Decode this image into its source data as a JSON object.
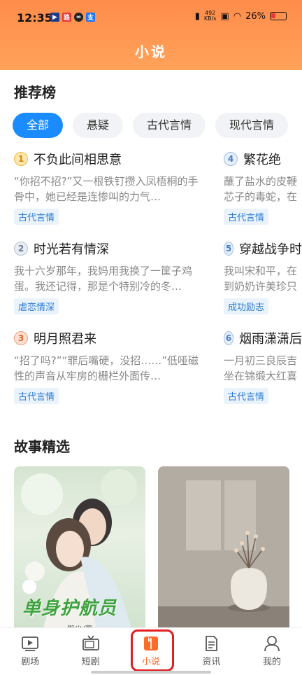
{
  "status_bar": {
    "time": "12:35",
    "net_speed_value": "492",
    "net_speed_unit": "KB/s",
    "battery": "26%"
  },
  "header": {
    "title": "小说"
  },
  "ranking": {
    "title": "推荐榜",
    "tabs": [
      "全部",
      "悬疑",
      "古代言情",
      "现代言情"
    ],
    "active_tab": "全部",
    "items": [
      {
        "rank": "1",
        "title": "不负此间相思意",
        "desc": "“你招不招?”又一根铁钉攒入凤梧桐的手骨中，她已经是连惨叫的力气…",
        "tag": "古代言情"
      },
      {
        "rank": "2",
        "title": "时光若有情深",
        "desc": "我十六岁那年，我妈用我换了一筐子鸡蛋。我还记得，那是个特别冷的冬…",
        "tag": "虐恋情深"
      },
      {
        "rank": "3",
        "title": "明月照君来",
        "desc": "“招了吗?”“罪后嘴硬，没招……”低哑磁性的声音从牢房的栅栏外面传…",
        "tag": "古代言情"
      },
      {
        "rank": "4",
        "title": "繁花绝",
        "desc": "蘸了盐水的皮鞭芯子的毒蛇，在",
        "tag": "古代言情"
      },
      {
        "rank": "5",
        "title": "穿越战争时",
        "desc": "我叫宋和平，在到奶奶许美珍只",
        "tag": "成功励志"
      },
      {
        "rank": "6",
        "title": "烟雨潇潇后",
        "desc": "一月初三良辰吉坐在锦缎大红喜",
        "tag": "古代言情"
      }
    ]
  },
  "stories": {
    "title": "故事精选",
    "items": [
      {
        "cover_title": "单身护航员",
        "cover_author": "舆尘/著"
      },
      {
        "cover_title": "",
        "cover_author": ""
      }
    ]
  },
  "bottom_nav": {
    "items": [
      "剧场",
      "短剧",
      "小说",
      "资讯",
      "我的"
    ],
    "active": "小说"
  },
  "colors": {
    "header_gradient_top": "#ff8c4a",
    "active_tab": "#1a8cff",
    "nav_active": "#ff6b2b",
    "highlight_box": "#e02020",
    "tag_text": "#2b7bd6"
  }
}
